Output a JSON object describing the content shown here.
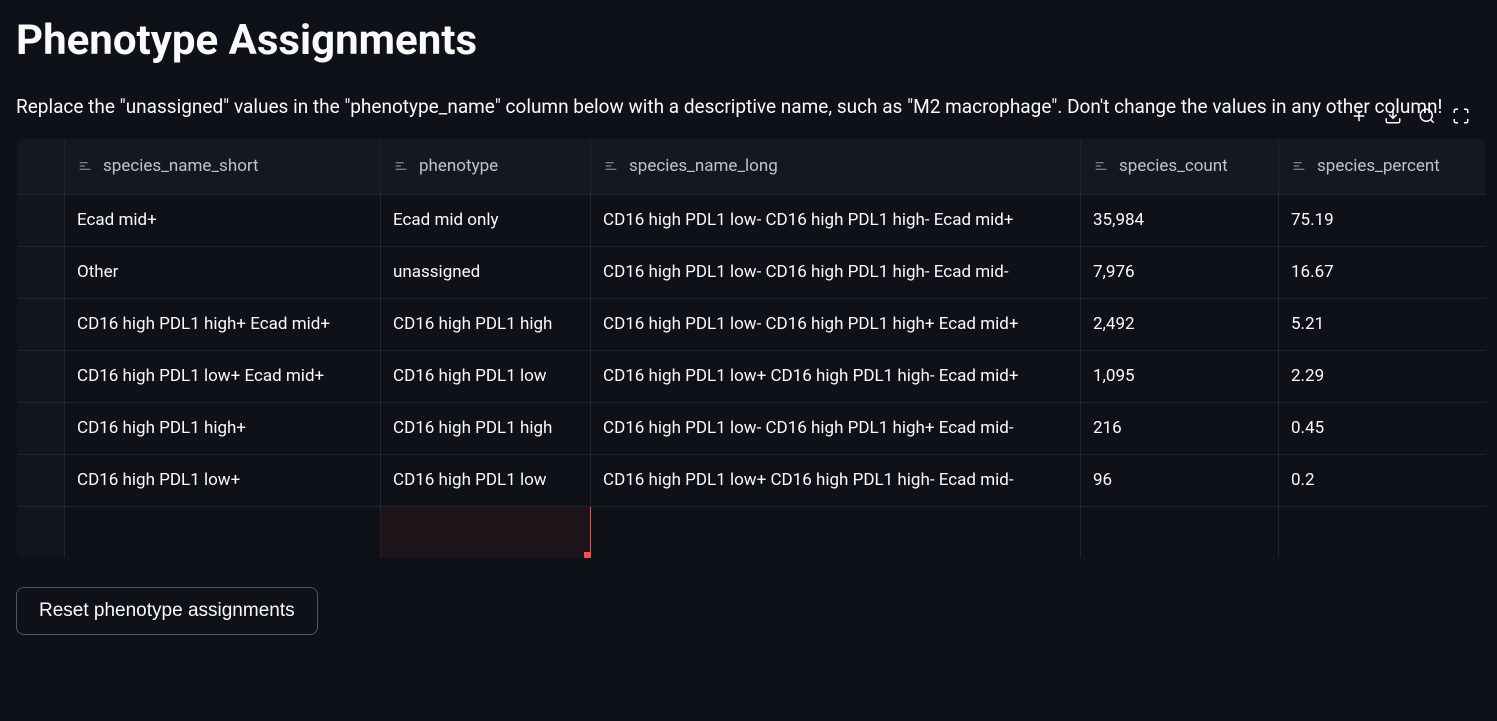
{
  "title": "Phenotype Assignments",
  "instructions": "Replace the \"unassigned\" values in the \"phenotype_name\" column below with a descriptive name, such as \"M2 macrophage\". Don't change the values in any other column!",
  "toolbar": {
    "add": "Add row",
    "download": "Download",
    "search": "Search",
    "fullscreen": "Fullscreen"
  },
  "columns": [
    "species_name_short",
    "phenotype",
    "species_name_long",
    "species_count",
    "species_percent"
  ],
  "rows": [
    {
      "species_name_short": "Ecad mid+",
      "phenotype": "Ecad mid only",
      "species_name_long": "CD16 high PDL1 low- CD16 high PDL1 high- Ecad mid+",
      "species_count": "35,984",
      "species_percent": "75.19"
    },
    {
      "species_name_short": "Other",
      "phenotype": "unassigned",
      "species_name_long": "CD16 high PDL1 low- CD16 high PDL1 high- Ecad mid-",
      "species_count": "7,976",
      "species_percent": "16.67"
    },
    {
      "species_name_short": "CD16 high PDL1 high+ Ecad mid+",
      "phenotype": "CD16 high PDL1 high",
      "species_name_long": "CD16 high PDL1 low- CD16 high PDL1 high+ Ecad mid+",
      "species_count": "2,492",
      "species_percent": "5.21"
    },
    {
      "species_name_short": "CD16 high PDL1 low+ Ecad mid+",
      "phenotype": "CD16 high PDL1 low",
      "species_name_long": "CD16 high PDL1 low+ CD16 high PDL1 high- Ecad mid+",
      "species_count": "1,095",
      "species_percent": "2.29"
    },
    {
      "species_name_short": "CD16 high PDL1 high+",
      "phenotype": "CD16 high PDL1 high",
      "species_name_long": "CD16 high PDL1 low- CD16 high PDL1 high+ Ecad mid-",
      "species_count": "216",
      "species_percent": "0.45"
    },
    {
      "species_name_short": "CD16 high PDL1 low+",
      "phenotype": "CD16 high PDL1 low",
      "species_name_long": "CD16 high PDL1 low+ CD16 high PDL1 high- Ecad mid-",
      "species_count": "96",
      "species_percent": "0.2"
    }
  ],
  "reset_label": "Reset phenotype assignments"
}
